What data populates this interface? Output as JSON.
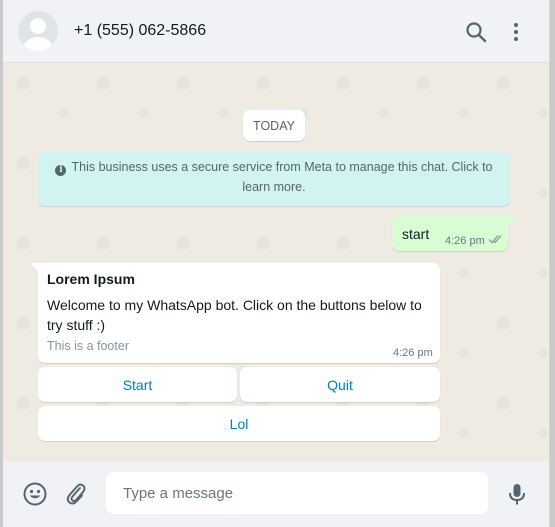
{
  "header": {
    "contact_name": "+1 (555) 062-5866",
    "icons": [
      "default-avatar-icon",
      "search-icon",
      "menu-icon"
    ]
  },
  "chat": {
    "date_chip": "TODAY",
    "system_message": "This business uses a secure service from Meta to manage this chat. Click to learn more.",
    "messages": [
      {
        "direction": "outgoing",
        "text": "start",
        "time": "4:26 pm",
        "status": "read"
      },
      {
        "direction": "incoming",
        "title": "Lorem Ipsum",
        "body": "Welcome to my WhatsApp bot. Click on the buttons below to try stuff :)",
        "footer": "This is a footer",
        "time": "4:26 pm",
        "buttons": [
          "Start",
          "Quit",
          "Lol"
        ]
      }
    ]
  },
  "composer": {
    "placeholder": "Type a message",
    "icons": [
      "emoji-icon",
      "attach-icon",
      "mic-icon"
    ]
  },
  "colors": {
    "header_bg": "#f0f2f5",
    "chat_bg": "#efeae2",
    "outgoing_bubble": "#d9fdd3",
    "system_bubble": "#d1f4f0",
    "button_text": "#027eb5",
    "read_ticks": "#53bdeb"
  }
}
